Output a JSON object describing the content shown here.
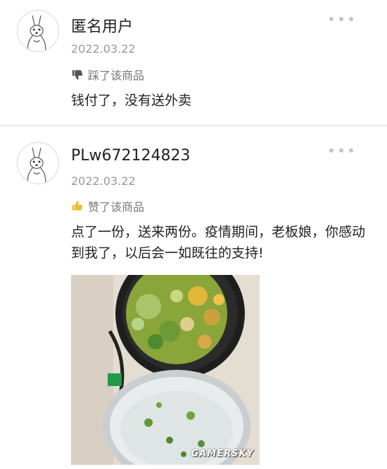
{
  "reviews": [
    {
      "username": "匿名用户",
      "date": "2022.03.22",
      "rating_icon": "thumbs-down-icon",
      "rating_text": "踩了该商品",
      "content": "钱付了，没有送外卖"
    },
    {
      "username": "PLw672124823",
      "date": "2022.03.22",
      "rating_icon": "thumbs-up-icon",
      "rating_text": "赞了该商品",
      "content": "点了一份，送来两份。疫情期间，老板娘，你感动到我了，以后会一如既往的支持!"
    }
  ],
  "colors": {
    "thumbs_up": "#f5b82e",
    "thumbs_down": "#555555"
  },
  "watermark": "GAMERSKY"
}
